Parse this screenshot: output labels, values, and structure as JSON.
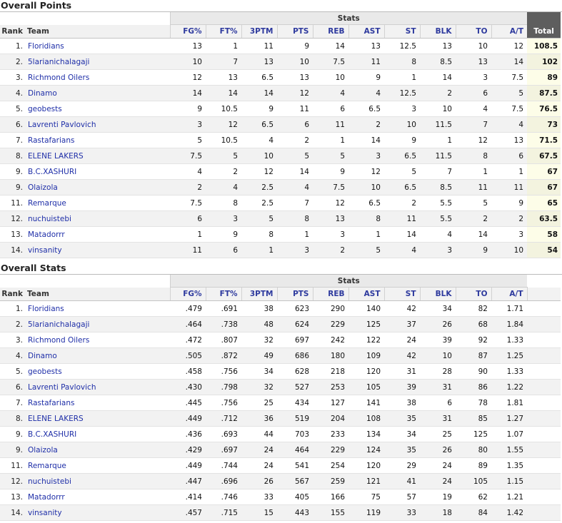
{
  "points": {
    "title": "Overall Points",
    "group_label": "Stats",
    "columns": {
      "rank": "Rank",
      "team": "Team",
      "stats": [
        "FG%",
        "FT%",
        "3PTM",
        "PTS",
        "REB",
        "AST",
        "ST",
        "BLK",
        "TO",
        "A/T"
      ],
      "total": "Total"
    },
    "rows": [
      {
        "rank": "1.",
        "team": "Floridians",
        "stats": [
          "13",
          "1",
          "11",
          "9",
          "14",
          "13",
          "12.5",
          "13",
          "10",
          "12"
        ],
        "total": "108.5"
      },
      {
        "rank": "2.",
        "team": "5larianichalagaji",
        "stats": [
          "10",
          "7",
          "13",
          "10",
          "7.5",
          "11",
          "8",
          "8.5",
          "13",
          "14"
        ],
        "total": "102"
      },
      {
        "rank": "3.",
        "team": "Richmond Oilers",
        "stats": [
          "12",
          "13",
          "6.5",
          "13",
          "10",
          "9",
          "1",
          "14",
          "3",
          "7.5"
        ],
        "total": "89"
      },
      {
        "rank": "4.",
        "team": "Dinamo",
        "stats": [
          "14",
          "14",
          "14",
          "12",
          "4",
          "4",
          "12.5",
          "2",
          "6",
          "5"
        ],
        "total": "87.5"
      },
      {
        "rank": "5.",
        "team": "geobests",
        "stats": [
          "9",
          "10.5",
          "9",
          "11",
          "6",
          "6.5",
          "3",
          "10",
          "4",
          "7.5"
        ],
        "total": "76.5"
      },
      {
        "rank": "6.",
        "team": "Lavrenti Pavlovich",
        "stats": [
          "3",
          "12",
          "6.5",
          "6",
          "11",
          "2",
          "10",
          "11.5",
          "7",
          "4"
        ],
        "total": "73"
      },
      {
        "rank": "7.",
        "team": "Rastafarians",
        "stats": [
          "5",
          "10.5",
          "4",
          "2",
          "1",
          "14",
          "9",
          "1",
          "12",
          "13"
        ],
        "total": "71.5"
      },
      {
        "rank": "8.",
        "team": "ELENE LAKERS",
        "stats": [
          "7.5",
          "5",
          "10",
          "5",
          "5",
          "3",
          "6.5",
          "11.5",
          "8",
          "6"
        ],
        "total": "67.5"
      },
      {
        "rank": "9.",
        "team": "B.C.XASHURI",
        "stats": [
          "4",
          "2",
          "12",
          "14",
          "9",
          "12",
          "5",
          "7",
          "1",
          "1"
        ],
        "total": "67"
      },
      {
        "rank": "9.",
        "team": "Olaizola",
        "stats": [
          "2",
          "4",
          "2.5",
          "4",
          "7.5",
          "10",
          "6.5",
          "8.5",
          "11",
          "11"
        ],
        "total": "67"
      },
      {
        "rank": "11.",
        "team": "Remarque",
        "stats": [
          "7.5",
          "8",
          "2.5",
          "7",
          "12",
          "6.5",
          "2",
          "5.5",
          "5",
          "9"
        ],
        "total": "65"
      },
      {
        "rank": "12.",
        "team": "nuchuistebi",
        "stats": [
          "6",
          "3",
          "5",
          "8",
          "13",
          "8",
          "11",
          "5.5",
          "2",
          "2"
        ],
        "total": "63.5"
      },
      {
        "rank": "13.",
        "team": "Matadorrr",
        "stats": [
          "1",
          "9",
          "8",
          "1",
          "3",
          "1",
          "14",
          "4",
          "14",
          "3"
        ],
        "total": "58"
      },
      {
        "rank": "14.",
        "team": "vinsanity",
        "stats": [
          "11",
          "6",
          "1",
          "3",
          "2",
          "5",
          "4",
          "3",
          "9",
          "10"
        ],
        "total": "54"
      }
    ]
  },
  "stats": {
    "title": "Overall Stats",
    "group_label": "Stats",
    "columns": {
      "rank": "Rank",
      "team": "Team",
      "stats": [
        "FG%",
        "FT%",
        "3PTM",
        "PTS",
        "REB",
        "AST",
        "ST",
        "BLK",
        "TO",
        "A/T"
      ]
    },
    "rows": [
      {
        "rank": "1.",
        "team": "Floridians",
        "stats": [
          ".479",
          ".691",
          "38",
          "623",
          "290",
          "140",
          "42",
          "34",
          "82",
          "1.71"
        ]
      },
      {
        "rank": "2.",
        "team": "5larianichalagaji",
        "stats": [
          ".464",
          ".738",
          "48",
          "624",
          "229",
          "125",
          "37",
          "26",
          "68",
          "1.84"
        ]
      },
      {
        "rank": "3.",
        "team": "Richmond Oilers",
        "stats": [
          ".472",
          ".807",
          "32",
          "697",
          "242",
          "122",
          "24",
          "39",
          "92",
          "1.33"
        ]
      },
      {
        "rank": "4.",
        "team": "Dinamo",
        "stats": [
          ".505",
          ".872",
          "49",
          "686",
          "180",
          "109",
          "42",
          "10",
          "87",
          "1.25"
        ]
      },
      {
        "rank": "5.",
        "team": "geobests",
        "stats": [
          ".458",
          ".756",
          "34",
          "628",
          "218",
          "120",
          "31",
          "28",
          "90",
          "1.33"
        ]
      },
      {
        "rank": "6.",
        "team": "Lavrenti Pavlovich",
        "stats": [
          ".430",
          ".798",
          "32",
          "527",
          "253",
          "105",
          "39",
          "31",
          "86",
          "1.22"
        ]
      },
      {
        "rank": "7.",
        "team": "Rastafarians",
        "stats": [
          ".445",
          ".756",
          "25",
          "434",
          "127",
          "141",
          "38",
          "6",
          "78",
          "1.81"
        ]
      },
      {
        "rank": "8.",
        "team": "ELENE LAKERS",
        "stats": [
          ".449",
          ".712",
          "36",
          "519",
          "204",
          "108",
          "35",
          "31",
          "85",
          "1.27"
        ]
      },
      {
        "rank": "9.",
        "team": "B.C.XASHURI",
        "stats": [
          ".436",
          ".693",
          "44",
          "703",
          "233",
          "134",
          "34",
          "25",
          "125",
          "1.07"
        ]
      },
      {
        "rank": "9.",
        "team": "Olaizola",
        "stats": [
          ".429",
          ".697",
          "24",
          "464",
          "229",
          "124",
          "35",
          "26",
          "80",
          "1.55"
        ]
      },
      {
        "rank": "11.",
        "team": "Remarque",
        "stats": [
          ".449",
          ".744",
          "24",
          "541",
          "254",
          "120",
          "29",
          "24",
          "89",
          "1.35"
        ]
      },
      {
        "rank": "12.",
        "team": "nuchuistebi",
        "stats": [
          ".447",
          ".696",
          "26",
          "567",
          "259",
          "121",
          "41",
          "24",
          "105",
          "1.15"
        ]
      },
      {
        "rank": "13.",
        "team": "Matadorrr",
        "stats": [
          ".414",
          ".746",
          "33",
          "405",
          "166",
          "75",
          "57",
          "19",
          "62",
          "1.21"
        ]
      },
      {
        "rank": "14.",
        "team": "vinsanity",
        "stats": [
          ".457",
          ".715",
          "15",
          "443",
          "155",
          "119",
          "33",
          "18",
          "84",
          "1.42"
        ]
      }
    ]
  }
}
